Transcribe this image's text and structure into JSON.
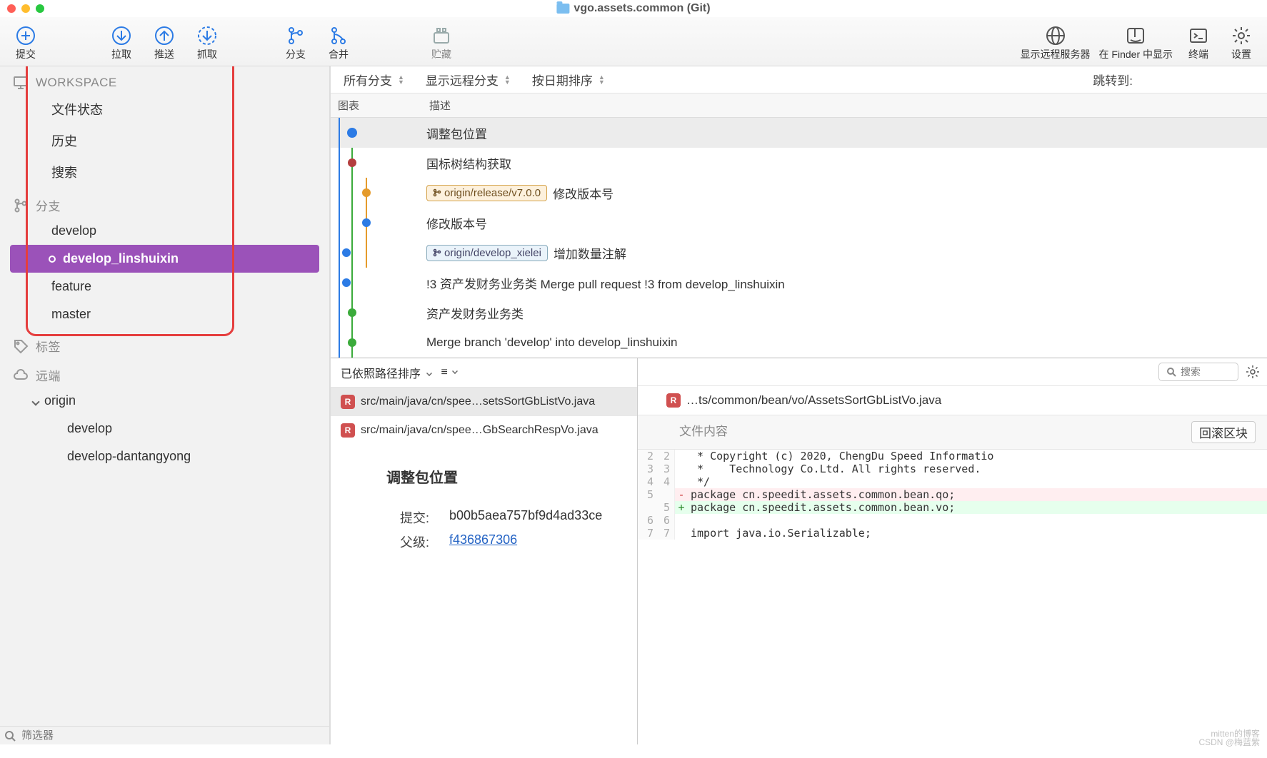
{
  "window": {
    "title": "vgo.assets.common (Git)"
  },
  "toolbar": {
    "commit": "提交",
    "pull": "拉取",
    "push": "推送",
    "fetch": "抓取",
    "branch": "分支",
    "merge": "合并",
    "stash": "贮藏",
    "remote": "显示远程服务器",
    "finder": "在 Finder 中显示",
    "terminal": "终端",
    "settings": "设置"
  },
  "sidebar": {
    "workspace_label": "WORKSPACE",
    "workspace": [
      "文件状态",
      "历史",
      "搜索"
    ],
    "branches_label": "分支",
    "branches": [
      "develop",
      "develop_linshuixin",
      "feature",
      "master"
    ],
    "tags_label": "标签",
    "remote_label": "远端",
    "origin_label": "origin",
    "remotes": [
      "develop",
      "develop-dantangyong"
    ],
    "filter_placeholder": "筛选器"
  },
  "filterbar": {
    "all_branches": "所有分支",
    "show_remote": "显示远程分支",
    "sort_date": "按日期排序",
    "jump_to": "跳转到:"
  },
  "commit_headers": {
    "graph": "图表",
    "desc": "描述"
  },
  "commits": [
    {
      "tag": null,
      "text": "调整包位置",
      "selected": true
    },
    {
      "tag": null,
      "text": "国标树结构获取"
    },
    {
      "tag": "origin/release/v7.0.0",
      "tagColor": "orange",
      "text": "修改版本号"
    },
    {
      "tag": null,
      "text": "修改版本号"
    },
    {
      "tag": "origin/develop_xielei",
      "text": "增加数量注解"
    },
    {
      "tag": null,
      "text": "!3 资产发财务业务类 Merge pull request !3 from develop_linshuixin"
    },
    {
      "tag": null,
      "text": "资产发财务业务类"
    },
    {
      "tag": null,
      "text": "Merge branch 'develop' into develop_linshuixin"
    }
  ],
  "path_sort": "已依照路径排序",
  "files": [
    "src/main/java/cn/spee…setsSortGbListVo.java",
    "src/main/java/cn/spee…GbSearchRespVo.java"
  ],
  "commit_info": {
    "title": "调整包位置",
    "commit_lbl": "提交:",
    "commit_val": "b00b5aea757bf9d4ad33ce",
    "parent_lbl": "父级:",
    "parent_val": "f436867306"
  },
  "right": {
    "search_placeholder": "搜索",
    "file": "…ts/common/bean/vo/AssetsSortGbListVo.java",
    "content_label": "文件内容",
    "revert_btn": "回滚区块"
  },
  "diff": [
    {
      "a": "2",
      "b": "2",
      "op": " ",
      "t": " * Copyright (c) 2020, ChengDu Speed Informatio"
    },
    {
      "a": "3",
      "b": "3",
      "op": " ",
      "t": " *    Technology Co.Ltd. All rights reserved."
    },
    {
      "a": "4",
      "b": "4",
      "op": " ",
      "t": " */"
    },
    {
      "a": "5",
      "b": "",
      "op": "-",
      "t": "package cn.speedit.assets.common.bean.qo;"
    },
    {
      "a": "",
      "b": "5",
      "op": "+",
      "t": "package cn.speedit.assets.common.bean.vo;"
    },
    {
      "a": "6",
      "b": "6",
      "op": " ",
      "t": ""
    },
    {
      "a": "7",
      "b": "7",
      "op": " ",
      "t": "import java.io.Serializable;"
    }
  ],
  "watermark1": "mitten的博客",
  "watermark2": "CSDN @梅蓝紫"
}
